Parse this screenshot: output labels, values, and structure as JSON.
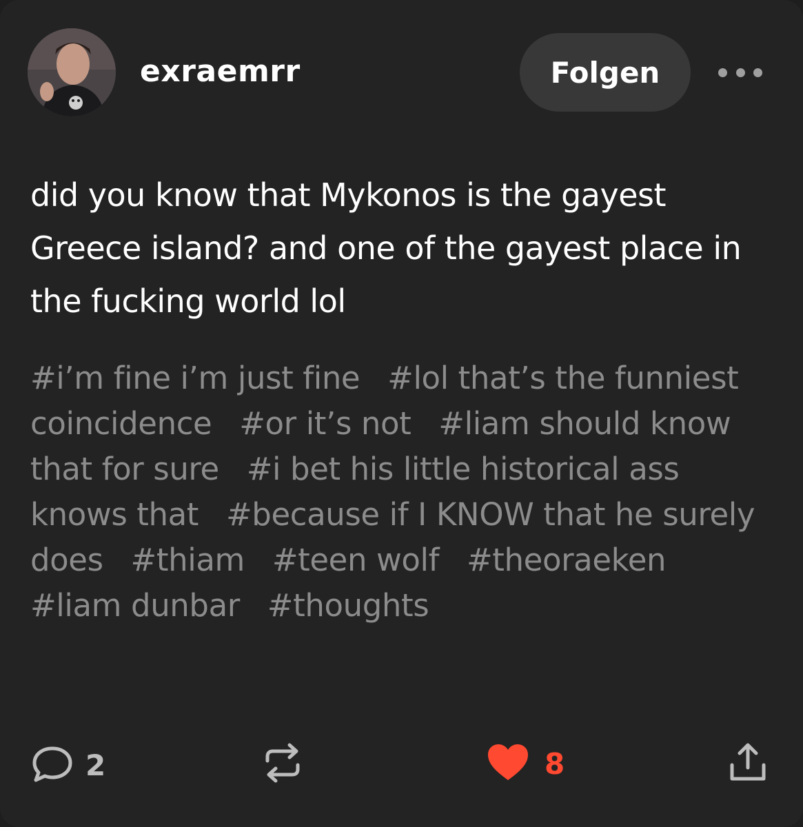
{
  "post": {
    "username": "exraemrr",
    "follow_label": "Folgen",
    "body": "did you know that Mykonos is the gayest Greece island? and one of the gayest place in the fucking world lol",
    "tags": [
      "#i’m fine i’m just fine",
      "#lol that’s the funniest coincidence",
      "#or it’s not",
      "#liam should know that for sure",
      "#i bet his little historical ass knows that",
      "#because if I KNOW that he surely does",
      "#thiam",
      "#teen wolf",
      "#theoraeken",
      "#liam dunbar",
      "#thoughts"
    ]
  },
  "actions": {
    "reply_count": "2",
    "like_count": "8"
  },
  "colors": {
    "background": "#232323",
    "tag_text": "#8c8c8c",
    "like_accent": "#ff4930",
    "button_bg": "#383838"
  },
  "icons": [
    "more-dots-icon",
    "reply-bubble-icon",
    "reblog-icon",
    "heart-icon",
    "share-icon"
  ]
}
